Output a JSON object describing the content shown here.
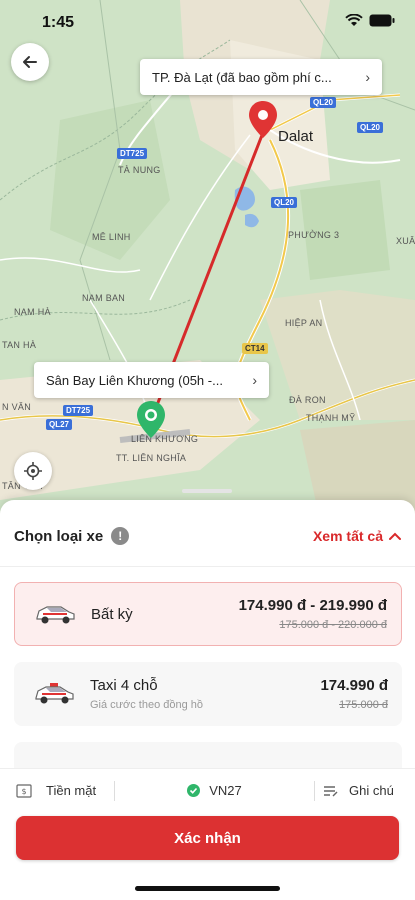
{
  "status_bar": {
    "time": "1:45"
  },
  "map": {
    "destination_label": "TP. Đà Lạt (đã bao gồm phí c...",
    "origin_label": "Sân Bay Liên Khương (05h -...",
    "city_labels": [
      "Dalat"
    ],
    "place_labels": [
      "TÀ NUNG",
      "MÊ LINH",
      "NAM BAN",
      "NAM HÀ",
      "PHƯỜNG 3",
      "HIỆP AN",
      "ĐÀ RON",
      "THẠNH MỸ",
      "LIÊN KHƯƠNG",
      "TT. LIÊN NGHĨA",
      "XUÂ",
      "TAN HÀ",
      "N VĂN",
      "TÂN THÀ"
    ],
    "road_badges": [
      "QL20",
      "QL20",
      "QL20",
      "DT725",
      "DT725",
      "QL27",
      "CT14"
    ]
  },
  "sheet": {
    "title": "Chọn loại xe",
    "see_all": "Xem tất cả",
    "vehicles": [
      {
        "name": "Bất kỳ",
        "subtitle": "",
        "price": "174.990 đ - 219.990 đ",
        "old_price": "175.000 đ - 220.000 đ",
        "selected": true
      },
      {
        "name": "Taxi 4 chỗ",
        "subtitle": "Giá cước theo đồng hồ",
        "price": "174.990 đ",
        "old_price": "175.000 đ",
        "selected": false
      }
    ]
  },
  "actions": {
    "payment": "Tiền mặt",
    "promo": "VN27",
    "note": "Ghi chú"
  },
  "confirm_label": "Xác nhận",
  "colors": {
    "accent": "#dc3132",
    "route": "#d62a2a",
    "origin_pin": "#2fb66a"
  }
}
